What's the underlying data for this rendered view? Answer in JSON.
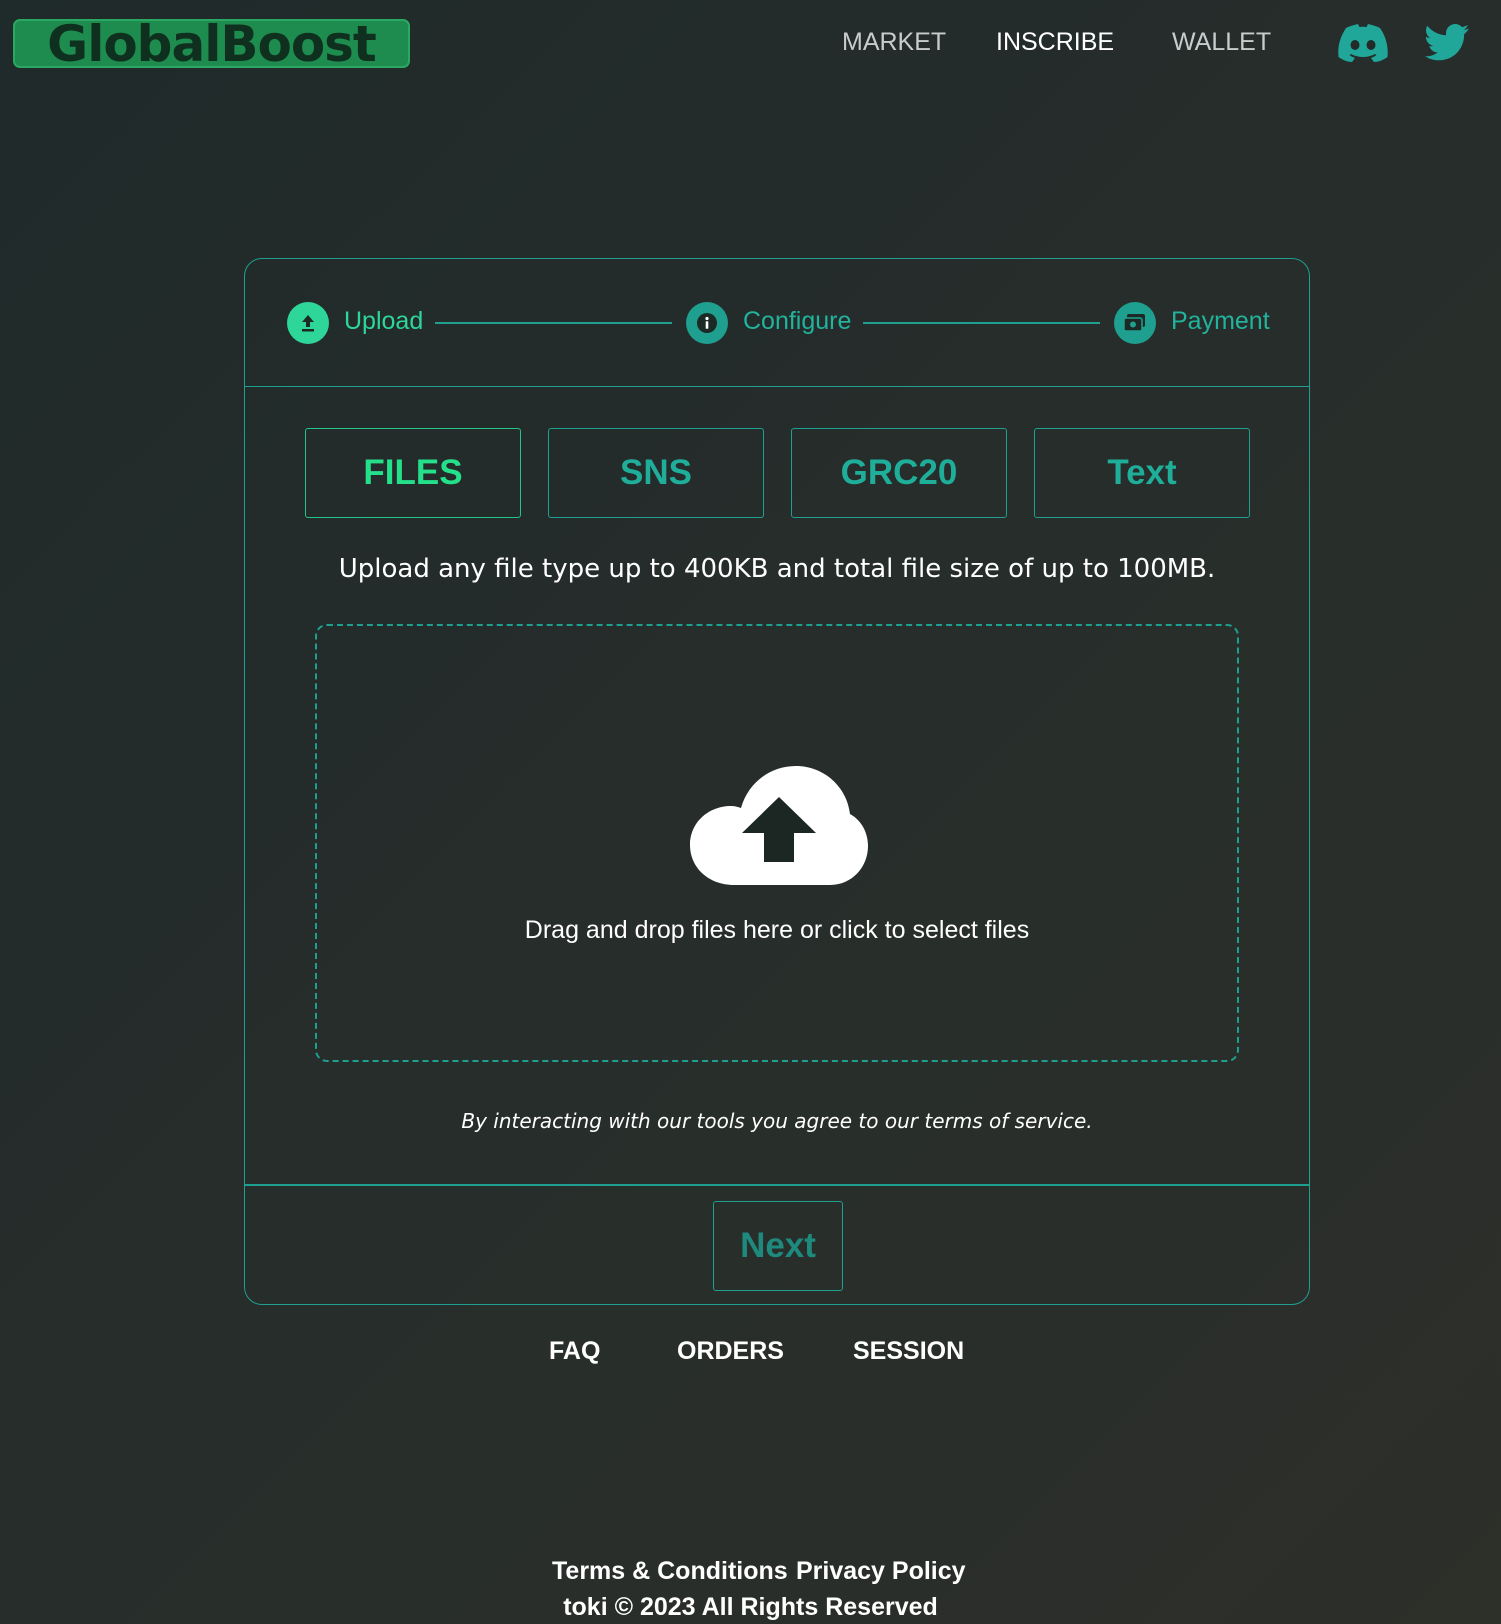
{
  "header": {
    "logo_text": "GlobalBoost",
    "nav": [
      {
        "label": "MARKET",
        "active": false
      },
      {
        "label": "INSCRIBE",
        "active": true
      },
      {
        "label": "WALLET",
        "active": false
      }
    ],
    "social_icons": [
      "discord-icon",
      "twitter-icon"
    ]
  },
  "stepper": {
    "steps": [
      {
        "label": "Upload",
        "icon": "upload-icon",
        "state": "current"
      },
      {
        "label": "Configure",
        "icon": "info-icon",
        "state": "pending"
      },
      {
        "label": "Payment",
        "icon": "payment-icon",
        "state": "pending"
      }
    ]
  },
  "tabs": [
    {
      "label": "FILES",
      "active": true
    },
    {
      "label": "SNS",
      "active": false
    },
    {
      "label": "GRC20",
      "active": false
    },
    {
      "label": "Text",
      "active": false
    }
  ],
  "upload": {
    "description": "Upload any file type up to 400KB and total file size of up to 100MB.",
    "dropzone_text": "Drag and drop files here or click to select files",
    "dropzone_icon": "cloud-upload-icon"
  },
  "terms_notice": "By interacting with our tools you agree to our terms of service.",
  "next_label": "Next",
  "bottom_nav": [
    "FAQ",
    "ORDERS",
    "SESSION"
  ],
  "footer": {
    "links": [
      "Terms & Conditions",
      "Privacy Policy"
    ],
    "copyright": "toki © 2023 All Rights Reserved"
  },
  "colors": {
    "accent": "#1f9f8f",
    "active_green": "#2ed69a",
    "logo_green": "#1e8c4f"
  }
}
